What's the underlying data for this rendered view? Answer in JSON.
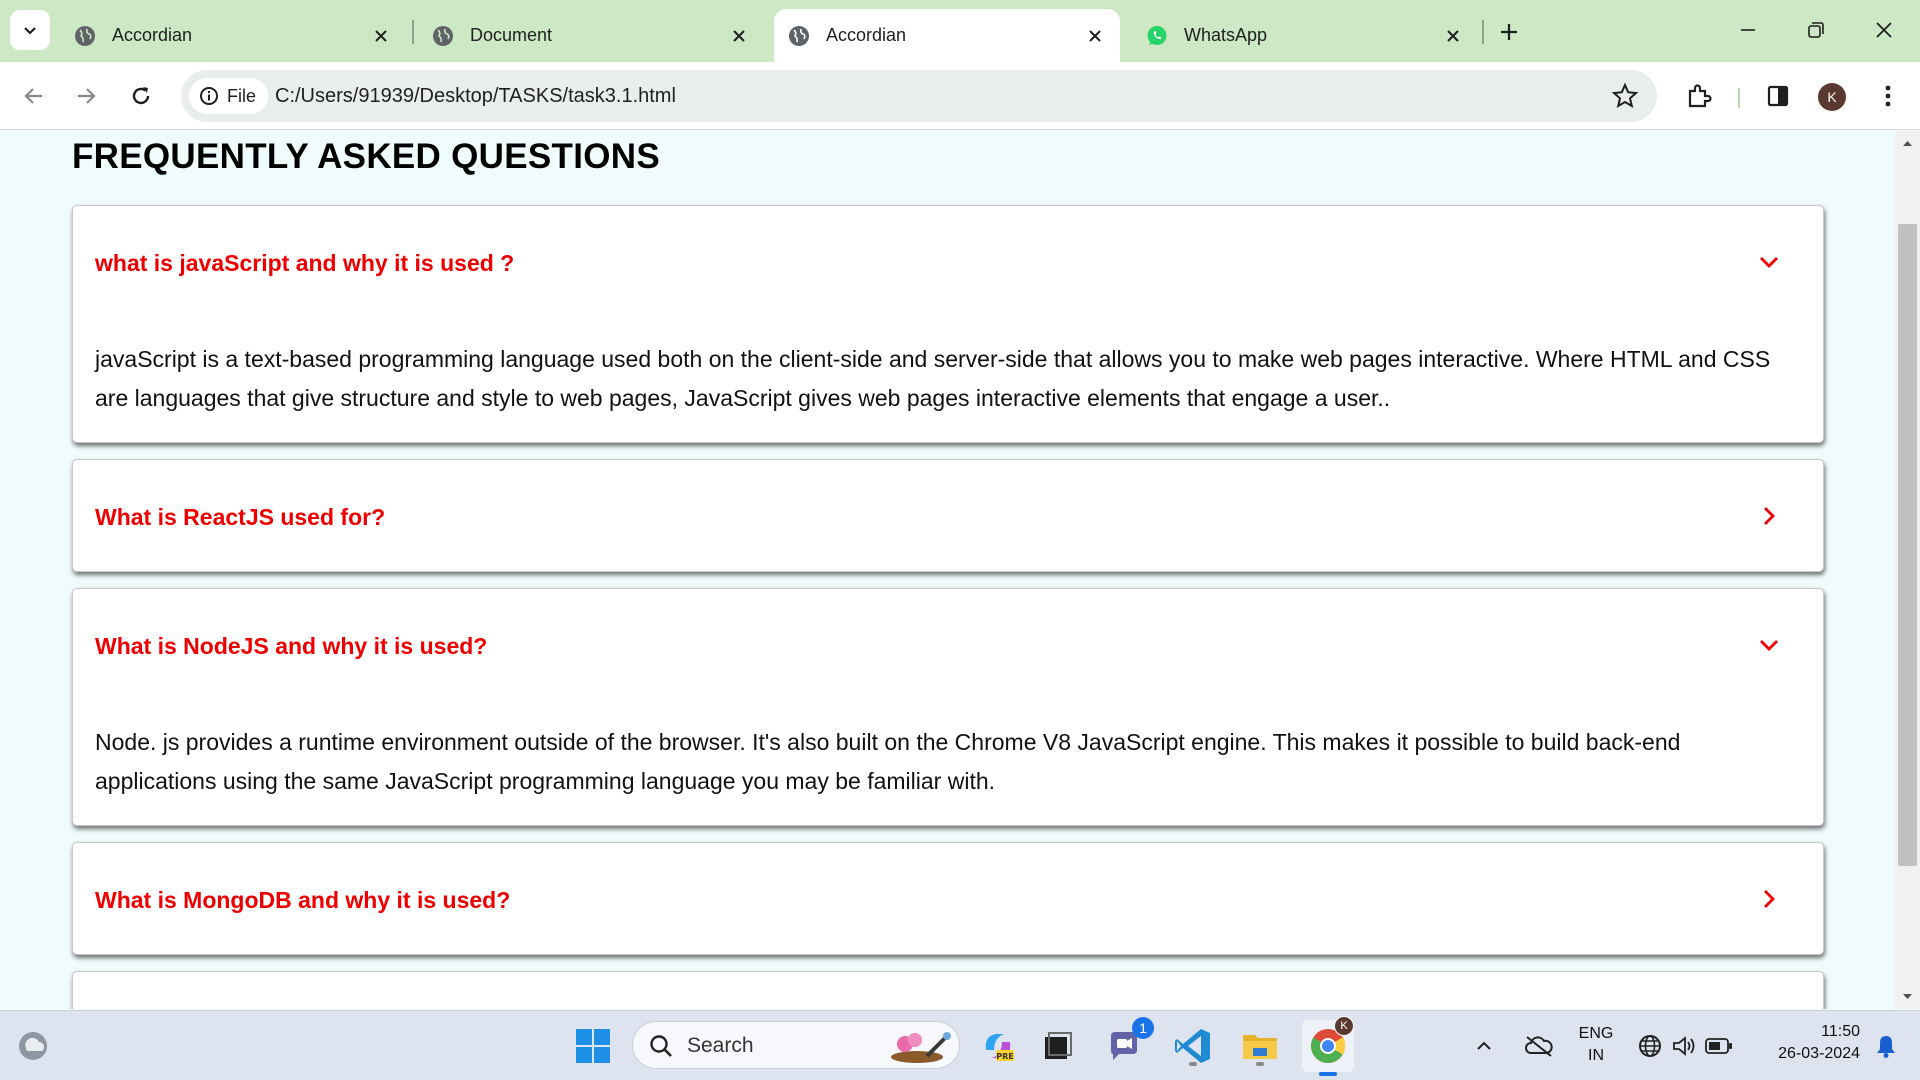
{
  "browser": {
    "tabs": [
      {
        "title": "Accordian",
        "active": false,
        "favicon": "globe-icon"
      },
      {
        "title": "Document",
        "active": false,
        "favicon": "globe-icon"
      },
      {
        "title": "Accordian",
        "active": true,
        "favicon": "globe-icon"
      },
      {
        "title": "WhatsApp",
        "active": false,
        "favicon": "whatsapp-icon"
      }
    ],
    "omnibox": {
      "scheme_chip": "File",
      "url": "C:/Users/91939/Desktop/TASKS/task3.1.html"
    },
    "profile_initial": "K",
    "colors": {
      "tabstrip": "#cde8c5",
      "omnibox": "#e9eeea",
      "avatar": "#5a3a30"
    }
  },
  "page": {
    "title": "FREQUENTLY ASKED QUESTIONS",
    "faqs": [
      {
        "question": "what is javaScript and why it is used ?",
        "expanded": true,
        "answer": "javaScript is a text-based programming language used both on the client-side and server-side that allows you to make web pages interactive. Where HTML and CSS are languages that give structure and style to web pages, JavaScript gives web pages interactive elements that engage a user.."
      },
      {
        "question": "What is ReactJS used for?",
        "expanded": false,
        "answer": ""
      },
      {
        "question": "What is NodeJS and why it is used?",
        "expanded": true,
        "answer": "Node. js provides a runtime environment outside of the browser. It's also built on the Chrome V8 JavaScript engine. This makes it possible to build back-end applications using the same JavaScript programming language you may be familiar with."
      },
      {
        "question": "What is MongoDB and why it is used?",
        "expanded": false,
        "answer": ""
      }
    ],
    "colors": {
      "question": "#ee0000",
      "background": "#f0fbfc"
    }
  },
  "taskbar": {
    "search_label": "Search",
    "teams_badge": "1",
    "chrome_badge": "K",
    "language": "ENG",
    "region": "IN",
    "time": "11:50",
    "date": "26-03-2024"
  }
}
